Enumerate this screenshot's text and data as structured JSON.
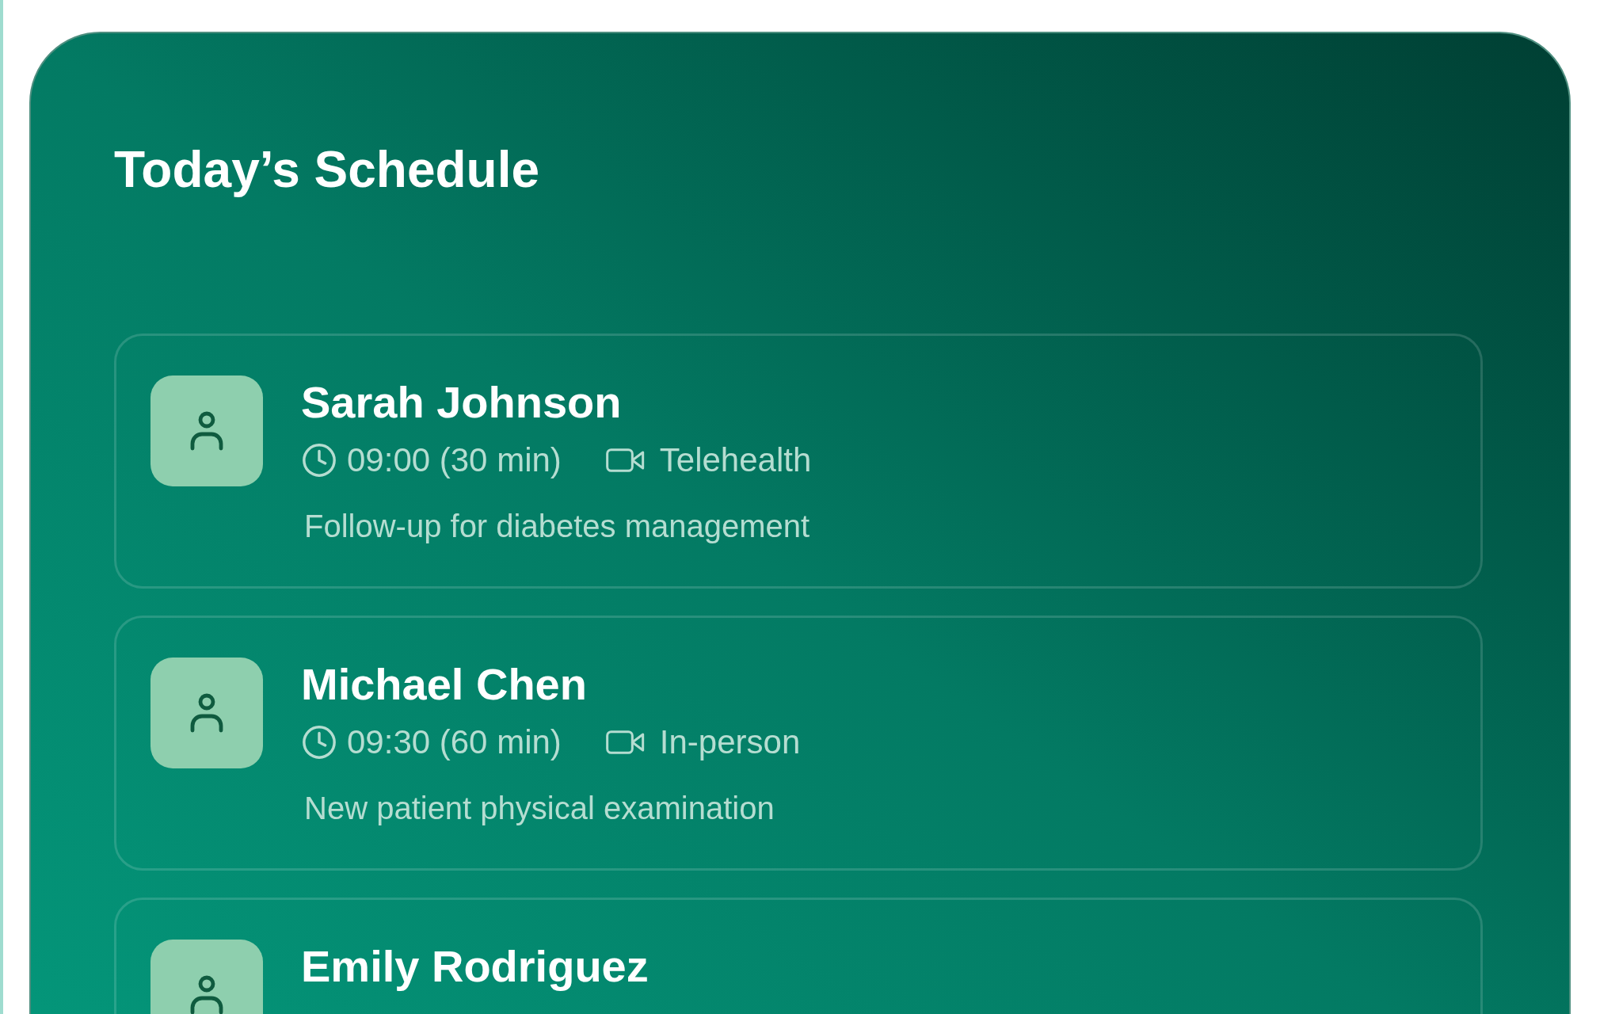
{
  "title": "Today’s Schedule",
  "appointments": [
    {
      "name": "Sarah Johnson",
      "time": "09:00 (30 min)",
      "mode": "Telehealth",
      "description": "Follow-up for diabetes management"
    },
    {
      "name": "Michael Chen",
      "time": "09:30 (60 min)",
      "mode": "In-person",
      "description": "New patient physical examination"
    },
    {
      "name": "Emily Rodriguez"
    }
  ]
}
